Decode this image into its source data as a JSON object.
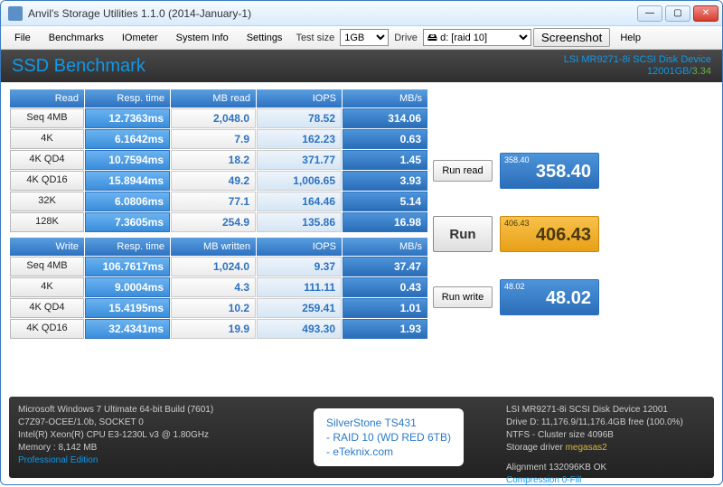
{
  "window": {
    "title": "Anvil's Storage Utilities 1.1.0 (2014-January-1)"
  },
  "menu": {
    "file": "File",
    "benchmarks": "Benchmarks",
    "iometer": "IOmeter",
    "system_info": "System Info",
    "settings": "Settings",
    "test_size_lbl": "Test size",
    "test_size_val": "1GB",
    "drive_lbl": "Drive",
    "drive_val": "🖴 d: [raid 10]",
    "screenshot": "Screenshot",
    "help": "Help"
  },
  "header": {
    "app": "SSD Benchmark",
    "device": "LSI MR9271-8i SCSI Disk Device",
    "capacity": "12001GB/",
    "ratio": "3.34"
  },
  "read_hdr": {
    "c0": "Read",
    "c1": "Resp. time",
    "c2": "MB read",
    "c3": "IOPS",
    "c4": "MB/s"
  },
  "read": [
    {
      "lbl": "Seq 4MB",
      "rt": "12.7363ms",
      "mb": "2,048.0",
      "iops": "78.52",
      "mbs": "314.06"
    },
    {
      "lbl": "4K",
      "rt": "6.1642ms",
      "mb": "7.9",
      "iops": "162.23",
      "mbs": "0.63"
    },
    {
      "lbl": "4K QD4",
      "rt": "10.7594ms",
      "mb": "18.2",
      "iops": "371.77",
      "mbs": "1.45"
    },
    {
      "lbl": "4K QD16",
      "rt": "15.8944ms",
      "mb": "49.2",
      "iops": "1,006.65",
      "mbs": "3.93"
    },
    {
      "lbl": "32K",
      "rt": "6.0806ms",
      "mb": "77.1",
      "iops": "164.46",
      "mbs": "5.14"
    },
    {
      "lbl": "128K",
      "rt": "7.3605ms",
      "mb": "254.9",
      "iops": "135.86",
      "mbs": "16.98"
    }
  ],
  "write_hdr": {
    "c0": "Write",
    "c1": "Resp. time",
    "c2": "MB written",
    "c3": "IOPS",
    "c4": "MB/s"
  },
  "write": [
    {
      "lbl": "Seq 4MB",
      "rt": "106.7617ms",
      "mb": "1,024.0",
      "iops": "9.37",
      "mbs": "37.47"
    },
    {
      "lbl": "4K",
      "rt": "9.0004ms",
      "mb": "4.3",
      "iops": "111.11",
      "mbs": "0.43"
    },
    {
      "lbl": "4K QD4",
      "rt": "15.4195ms",
      "mb": "10.2",
      "iops": "259.41",
      "mbs": "1.01"
    },
    {
      "lbl": "4K QD16",
      "rt": "32.4341ms",
      "mb": "19.9",
      "iops": "493.30",
      "mbs": "1.93"
    }
  ],
  "scores": {
    "run_read": "Run read",
    "read_sm": "358.40",
    "read_lg": "358.40",
    "run": "Run",
    "total_sm": "406.43",
    "total_lg": "406.43",
    "run_write": "Run write",
    "write_sm": "48.02",
    "write_lg": "48.02"
  },
  "footer": {
    "os": "Microsoft Windows 7 Ultimate  64-bit Build (7601)",
    "mb": "C7Z97-OCEE/1.0b, SOCKET 0",
    "cpu": "Intel(R) Xeon(R) CPU E3-1230L v3 @ 1.80GHz",
    "mem": "Memory : 8,142 MB",
    "edition": "Professional Edition",
    "note1": "SilverStone TS431",
    "note2": "- RAID 10 (WD RED 6TB)",
    "note3": "- eTeknix.com",
    "dev": "LSI MR9271-8i SCSI Disk Device 12001",
    "drv": "Drive D: 11,176.9/11,176.4GB free (100.0%)",
    "fs": "NTFS - Cluster size 4096B",
    "sd_lbl": "Storage driver ",
    "sd_val": "megasas2",
    "align": "Alignment 132096KB OK",
    "comp": "Compression 0-Fill"
  }
}
